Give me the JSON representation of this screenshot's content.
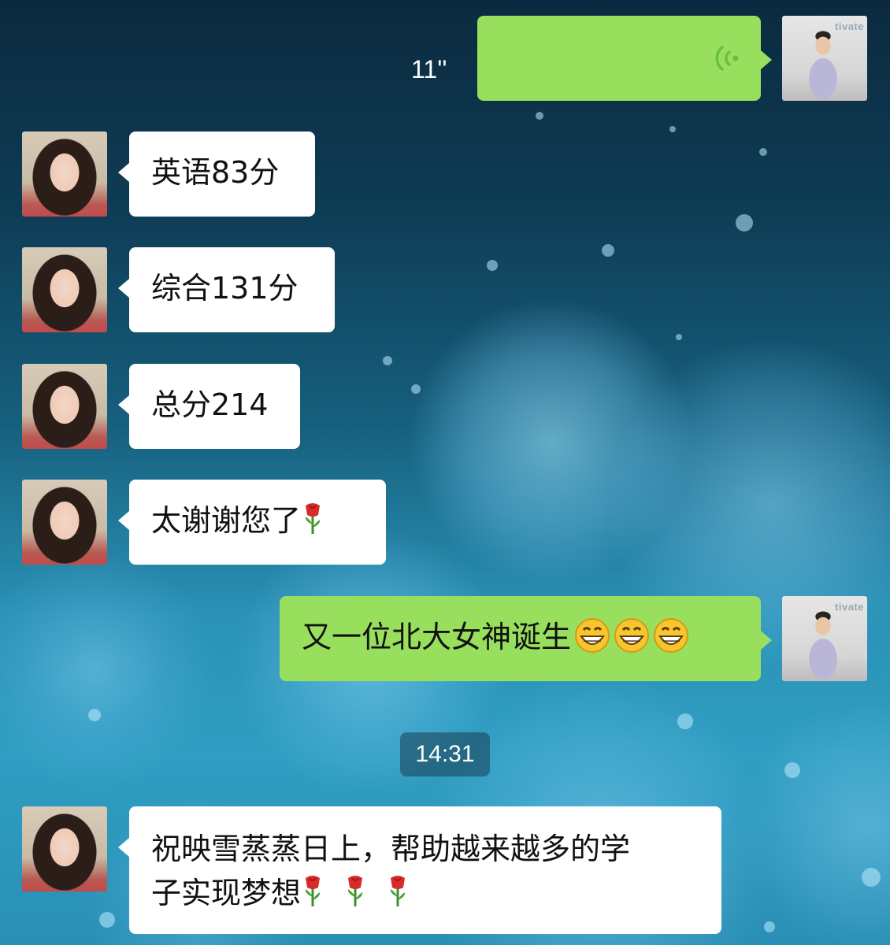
{
  "messages": [
    {
      "sender": "self",
      "type": "voice",
      "duration": "11''"
    },
    {
      "sender": "other",
      "type": "text",
      "text": "英语83分"
    },
    {
      "sender": "other",
      "type": "text",
      "text": "综合131分"
    },
    {
      "sender": "other",
      "type": "text",
      "text": "总分214"
    },
    {
      "sender": "other",
      "type": "text",
      "text": "太谢谢您了",
      "emojis": [
        "rose"
      ]
    },
    {
      "sender": "self",
      "type": "text",
      "text": "又一位北大女神诞生",
      "emojis": [
        "grin",
        "grin",
        "grin"
      ]
    },
    {
      "sender": "other",
      "type": "text",
      "text_line1": "祝映雪蒸蒸日上，帮助越来越多的学",
      "text_line2": "子实现梦想",
      "emojis": [
        "rose",
        "rose",
        "rose"
      ]
    }
  ],
  "timestamp": "14:31",
  "avatar_self_brand": "tivate",
  "colors": {
    "outgoing_bubble": "#98df5e",
    "incoming_bubble": "#ffffff",
    "voice_icon": "#6cbf3a"
  }
}
